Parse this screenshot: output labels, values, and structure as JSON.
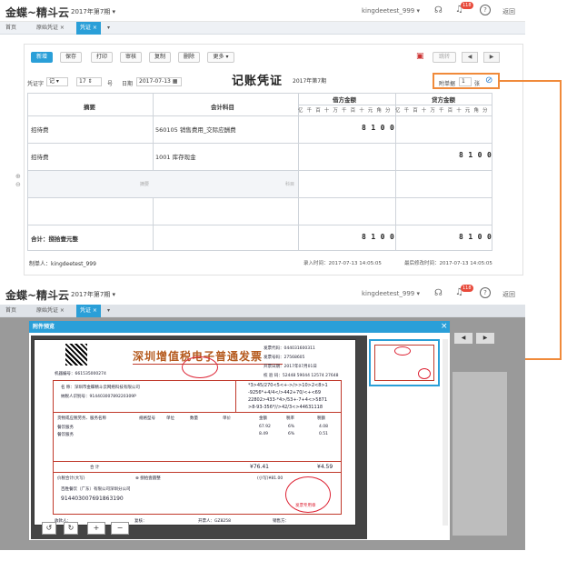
{
  "app": {
    "brand": "金蝶~精斗云",
    "period": "2017年第7期",
    "account": "kingdeetest_999",
    "notification_count": "118",
    "back_label": "返回"
  },
  "tabs": [
    "首页",
    "原始凭证",
    "凭证"
  ],
  "toolbar": {
    "new": "新增",
    "save": "保存",
    "print": "打印",
    "review": "审核",
    "copy": "复制",
    "delete": "删除",
    "more": "更多",
    "jump": "跳转"
  },
  "voucher": {
    "title": "记账凭证",
    "period": "2017年第7期",
    "word_label": "凭证字",
    "word_value": "记",
    "number_value": "17",
    "number_unit": "号",
    "date_label": "日期",
    "date_value": "2017-07-13",
    "attach_label": "附单据",
    "attach_value": "1",
    "attach_unit": "张"
  },
  "grid": {
    "headers": {
      "summary": "摘要",
      "account": "会计科目",
      "debit": "借方金额",
      "credit": "贷方金额"
    },
    "digits": [
      "亿",
      "千",
      "百",
      "十",
      "万",
      "千",
      "百",
      "十",
      "元",
      "角",
      "分"
    ],
    "rows": [
      {
        "summary": "招待费",
        "account": "560105 销售费用_交际应酬费",
        "debit": "8100",
        "credit": ""
      },
      {
        "summary": "招待费",
        "account": "1001 库存现金",
        "debit": "",
        "credit": "8100"
      },
      {
        "summary_placeholder": "摘要",
        "account_placeholder": "科目"
      }
    ],
    "total_label": "合计：捌拾壹元整",
    "total_debit": "8100",
    "total_credit": "8100"
  },
  "footer": {
    "maker": "制单人：kingdeetest_999",
    "entry_time": "录入时间：2017-07-13 14:05:05",
    "modify_time": "最后修改时间：2017-07-13 14:05:05"
  },
  "preview": {
    "dialog_title": "附件预览",
    "close": "×",
    "invoice_title": "深圳增值税电子普通发票",
    "invoice_code_label": "发票代码",
    "invoice_code": "044031600311",
    "invoice_no_label": "发票号码",
    "invoice_no": "27568605",
    "invoice_date_label": "开票日期",
    "invoice_date": "2017年07月01日",
    "check_code_label": "校 验 码",
    "check_code": "52448 59044 12574 27648",
    "machine_no_label": "机器编号",
    "machine_no": "661535000274",
    "buyer_name_label": "名 称",
    "buyer_name": "深圳市金蝶精斗云网络科技有限公司",
    "buyer_tax_label": "纳税人识别号",
    "buyer_tax": "91440300789220309P",
    "cipher": [
      "*3>45/270<5<+->/>>10>2<8>1",
      "-9256*+4/4</>442+70/<+<69",
      "22802>433-*4>/53+-7+4<>5871",
      ">8-93-356*//>42/3<>44631118"
    ],
    "item_headers": [
      "货物或应税劳务、服务名称",
      "规格型号",
      "单位",
      "数量",
      "单价",
      "金额",
      "税率",
      "税额"
    ],
    "items": [
      {
        "name": "餐饮服务",
        "amount": "67.92",
        "rate": "6%",
        "tax": "4.08"
      },
      {
        "name": "餐饮服务",
        "amount": "8.49",
        "rate": "6%",
        "tax": "0.51"
      }
    ],
    "sum_label": "合 计",
    "sum_amount": "¥76.41",
    "sum_tax": "¥4.59",
    "total_words_label": "价税合计(大写)",
    "total_words": "捌拾壹圆整",
    "total_small": "(小写)¥81.00",
    "seller_name": "百胜餐饮（广东）有限公司深圳分公司",
    "seller_tax": "914403007691863190",
    "payee_label": "收款人：",
    "reviewer_label": "复核：",
    "drawer_label": "开票人：",
    "drawer": "GZ8258",
    "seller_label": "销售方：",
    "stamp_text": "发票专用章",
    "controls": [
      "↺",
      "↻",
      "+",
      "−"
    ]
  }
}
